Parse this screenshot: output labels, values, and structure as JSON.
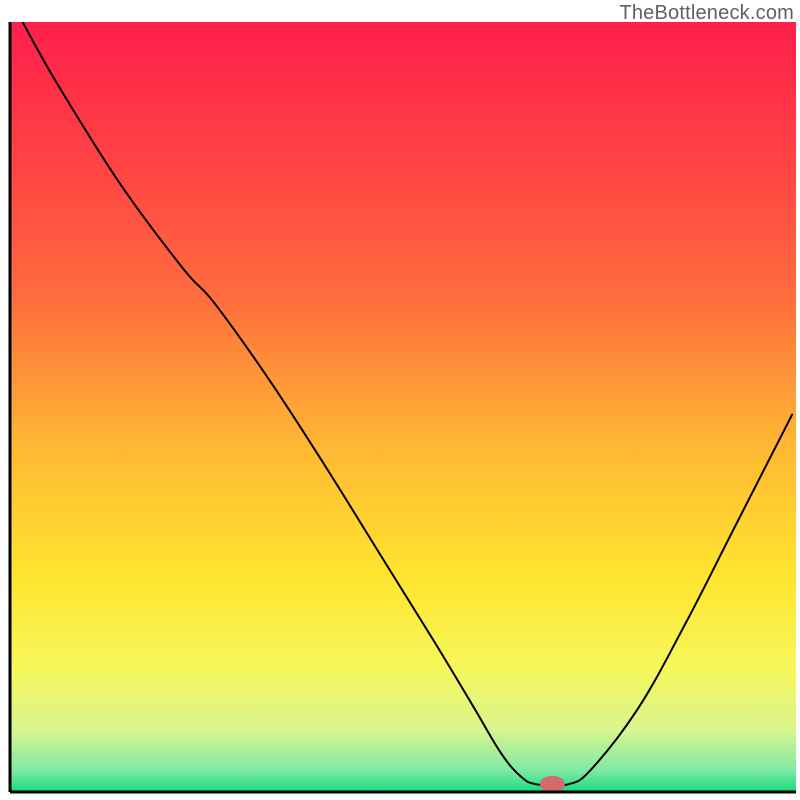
{
  "watermark": "TheBottleneck.com",
  "chart_data": {
    "type": "line",
    "title": "",
    "xlabel": "",
    "ylabel": "",
    "xlim": [
      0,
      100
    ],
    "ylim": [
      0,
      100
    ],
    "gradient_stops": [
      {
        "offset": 0.0,
        "color": "#ff1f4b"
      },
      {
        "offset": 0.18,
        "color": "#ff4244"
      },
      {
        "offset": 0.35,
        "color": "#ff6a3e"
      },
      {
        "offset": 0.55,
        "color": "#ffb733"
      },
      {
        "offset": 0.72,
        "color": "#ffe52f"
      },
      {
        "offset": 0.84,
        "color": "#f6f75b"
      },
      {
        "offset": 0.92,
        "color": "#d8f58e"
      },
      {
        "offset": 0.972,
        "color": "#7fe9a5"
      },
      {
        "offset": 1.0,
        "color": "#16db7f"
      }
    ],
    "series": [
      {
        "name": "bottleneck-curve",
        "color": "#000000",
        "width": 2,
        "points": [
          {
            "x": 1.6,
            "y": 100.0
          },
          {
            "x": 6.0,
            "y": 92.0
          },
          {
            "x": 14.0,
            "y": 79.0
          },
          {
            "x": 22.0,
            "y": 68.0
          },
          {
            "x": 26.0,
            "y": 63.5
          },
          {
            "x": 33.0,
            "y": 53.5
          },
          {
            "x": 40.0,
            "y": 42.5
          },
          {
            "x": 47.0,
            "y": 31.0
          },
          {
            "x": 54.0,
            "y": 19.5
          },
          {
            "x": 59.0,
            "y": 11.0
          },
          {
            "x": 62.5,
            "y": 5.0
          },
          {
            "x": 65.0,
            "y": 2.0
          },
          {
            "x": 67.0,
            "y": 1.0
          },
          {
            "x": 71.0,
            "y": 1.0
          },
          {
            "x": 74.0,
            "y": 3.0
          },
          {
            "x": 80.0,
            "y": 11.0
          },
          {
            "x": 86.0,
            "y": 22.0
          },
          {
            "x": 92.0,
            "y": 34.0
          },
          {
            "x": 98.0,
            "y": 46.0
          },
          {
            "x": 99.5,
            "y": 49.0
          }
        ]
      }
    ],
    "marker": {
      "x": 69.0,
      "y": 1.0,
      "color": "#d46a6a",
      "rx": 1.6,
      "ry": 1.1
    },
    "border": {
      "left": true,
      "bottom": true,
      "color": "#000000",
      "width": 3
    }
  }
}
